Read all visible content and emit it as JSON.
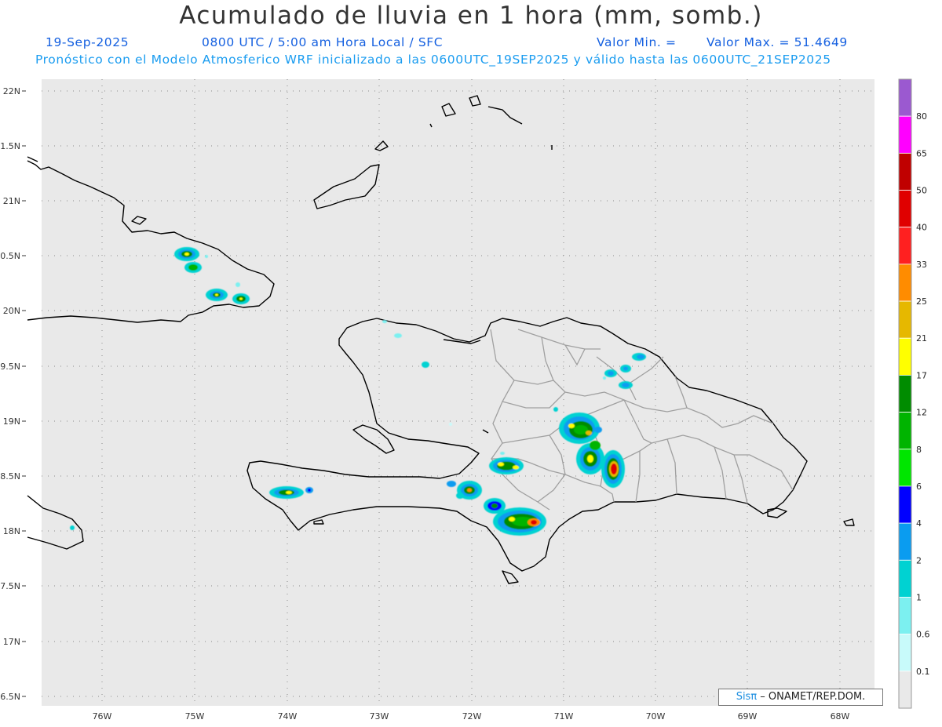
{
  "header": {
    "title": "Acumulado de lluvia en 1 hora (mm, somb.)",
    "date": "19-Sep-2025",
    "time": "0800 UTC / 5:00 am Hora Local / SFC",
    "min_label": "Valor Min. =",
    "max_label": "Valor Max. = 51.4649",
    "forecast_info": "Pronóstico con el Modelo Atmosferico WRF inicializado a las 0600UTC_19SEP2025 y válido hasta las  0600UTC_21SEP2025"
  },
  "axes": {
    "lat_ticks": [
      "22N",
      "1.5N",
      "21N",
      "0.5N",
      "20N",
      "9.5N",
      "19N",
      "8.5N",
      "18N",
      "7.5N",
      "17N",
      "6.5N"
    ],
    "lon_ticks": [
      "76W",
      "75W",
      "74W",
      "73W",
      "72W",
      "71W",
      "70W",
      "69W",
      "68W"
    ]
  },
  "legend": {
    "labels": [
      "80",
      "65",
      "50",
      "40",
      "33",
      "25",
      "21",
      "17",
      "12",
      "8",
      "6",
      "4",
      "2",
      "1",
      "0.6",
      "0.1"
    ],
    "colors": [
      "#9b59d0",
      "#ff00ff",
      "#c00000",
      "#e00000",
      "#ff2020",
      "#ff8c00",
      "#e6b800",
      "#ffff00",
      "#008c00",
      "#00b400",
      "#00e600",
      "#0000ff",
      "#0a9cf0",
      "#00d2d2",
      "#7cf0f0",
      "#c8fafa",
      "#e9e9e9"
    ]
  },
  "footer": {
    "brand": "Sisπ",
    "credit": " – ONAMET/REP.DOM."
  },
  "colors": {
    "map_background": "#e9e9e9",
    "coast": "#000000",
    "provinces": "#a0a0a0",
    "grid": "#8c8c8c"
  }
}
